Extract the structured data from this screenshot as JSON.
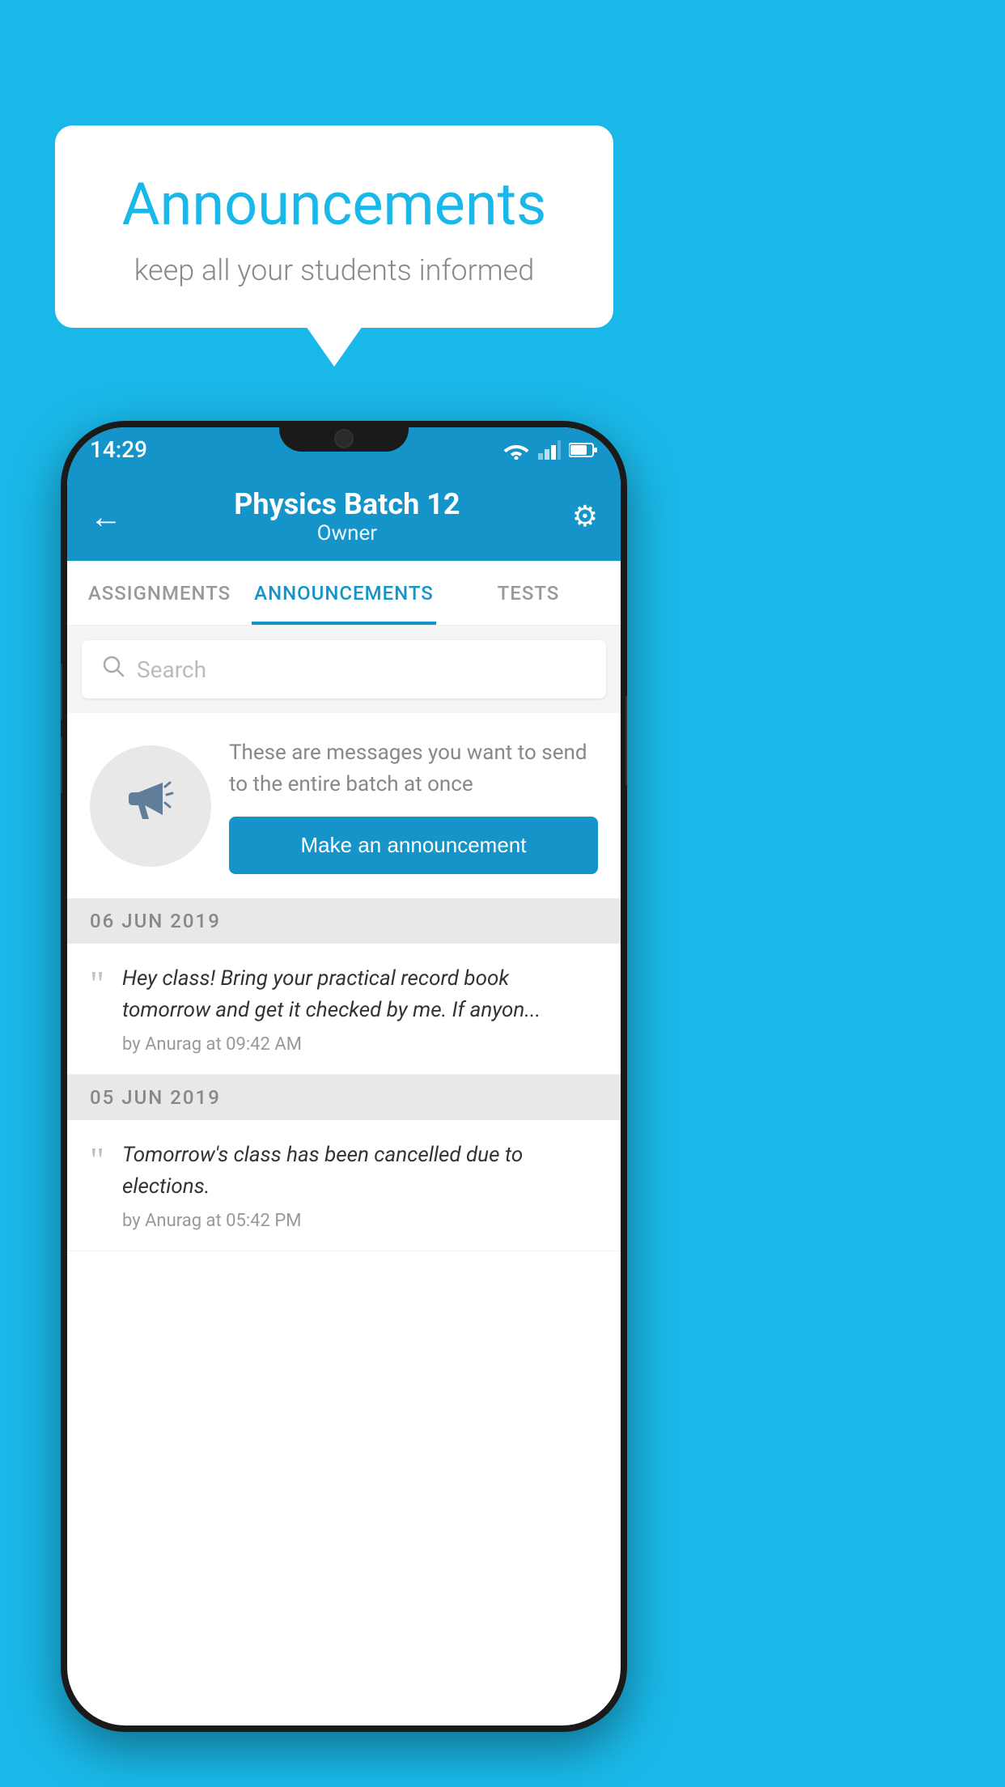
{
  "background_color": "#1ab8e8",
  "speech_bubble": {
    "title": "Announcements",
    "subtitle": "keep all your students informed"
  },
  "phone": {
    "status_bar": {
      "time": "14:29"
    },
    "nav_bar": {
      "title": "Physics Batch 12",
      "subtitle": "Owner",
      "back_icon": "←",
      "gear_icon": "⚙"
    },
    "tabs": [
      {
        "label": "ASSIGNMENTS",
        "active": false
      },
      {
        "label": "ANNOUNCEMENTS",
        "active": true
      },
      {
        "label": "TESTS",
        "active": false
      }
    ],
    "search": {
      "placeholder": "Search"
    },
    "promo_card": {
      "description": "These are messages you want to send to the entire batch at once",
      "button_label": "Make an announcement"
    },
    "announcement_groups": [
      {
        "date": "06  JUN  2019",
        "items": [
          {
            "text": "Hey class! Bring your practical record book tomorrow and get it checked by me. If anyon...",
            "meta": "by Anurag at 09:42 AM"
          }
        ]
      },
      {
        "date": "05  JUN  2019",
        "items": [
          {
            "text": "Tomorrow's class has been cancelled due to elections.",
            "meta": "by Anurag at 05:42 PM"
          }
        ]
      }
    ]
  }
}
